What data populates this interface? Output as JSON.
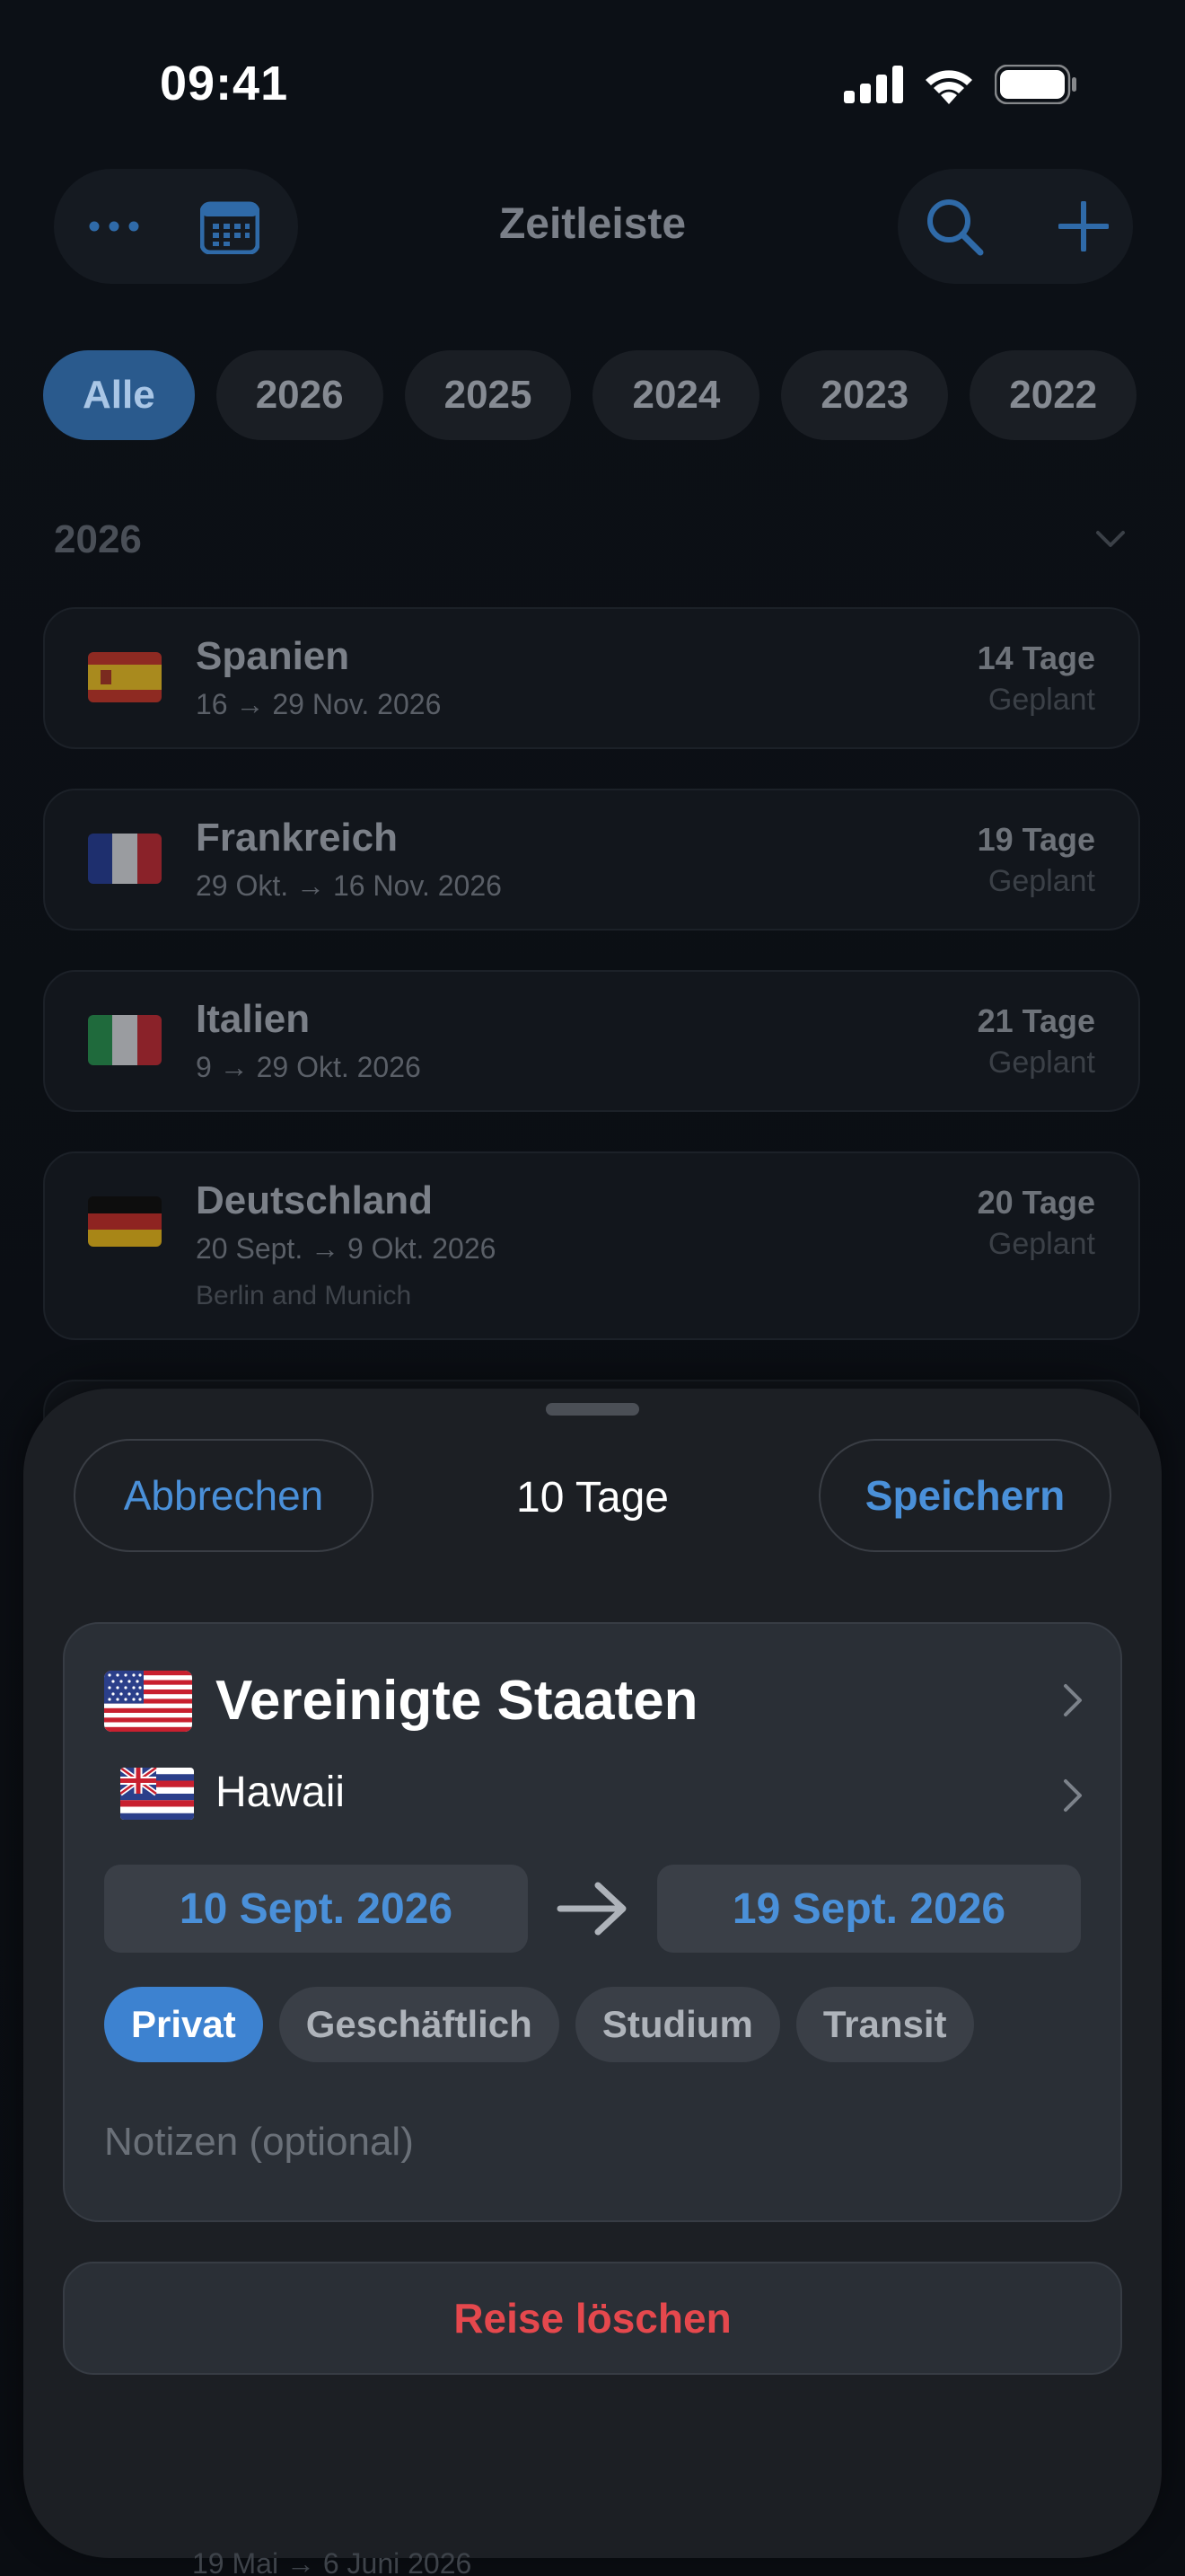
{
  "status_bar": {
    "time": "09:41",
    "icons": [
      "cellular-signal-icon",
      "wifi-icon",
      "battery-icon"
    ]
  },
  "toolbar": {
    "title": "Zeitleiste",
    "left_icons": [
      "ellipsis-icon",
      "calendar-icon"
    ],
    "right_icons": [
      "search-icon",
      "plus-icon"
    ]
  },
  "year_filter": [
    "Alle",
    "2026",
    "2025",
    "2024",
    "2023",
    "2022"
  ],
  "section": {
    "year": "2026"
  },
  "trips": [
    {
      "country": "Spanien",
      "dates": "16 → 29 Nov. 2026",
      "note": "",
      "days": "14 Tage",
      "status": "Geplant"
    },
    {
      "country": "Frankreich",
      "dates": "29 Okt. → 16 Nov. 2026",
      "note": "",
      "days": "19 Tage",
      "status": "Geplant"
    },
    {
      "country": "Italien",
      "dates": "9 → 29 Okt. 2026",
      "note": "",
      "days": "21 Tage",
      "status": "Geplant"
    },
    {
      "country": "Deutschland",
      "dates": "20 Sept. → 9 Okt. 2026",
      "note": "Berlin and Munich",
      "days": "20 Tage",
      "status": "Geplant"
    }
  ],
  "peek_text": "19 Mai → 6 Juni 2026",
  "sheet": {
    "cancel_label": "Abbrechen",
    "title": "10 Tage",
    "save_label": "Speichern",
    "country": "Vereinigte Staaten",
    "region": "Hawaii",
    "start_date": "10 Sept. 2026",
    "end_date": "19 Sept. 2026",
    "trip_types": [
      "Privat",
      "Geschäftlich",
      "Studium",
      "Transit"
    ],
    "selected_type": "Privat",
    "notes_placeholder": "Notizen (optional)",
    "delete_label": "Reise löschen"
  },
  "colors": {
    "accent": "#4a90d9",
    "destructive": "#e5484d",
    "sheet_bg": "#1c1f24"
  }
}
